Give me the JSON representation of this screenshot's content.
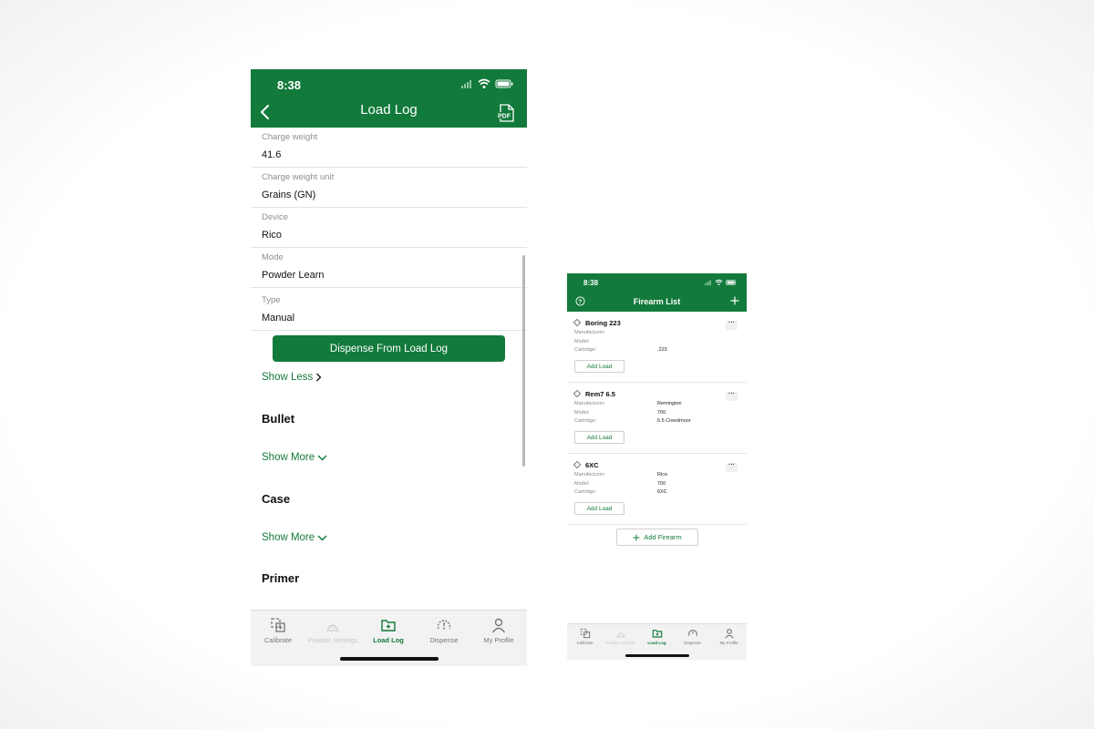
{
  "load_log_screen": {
    "status_time": "8:38",
    "title": "Load Log",
    "fields": [
      {
        "label": "Charge weight",
        "value": "41.6"
      },
      {
        "label": "Charge weight unit",
        "value": "Grains (GN)"
      },
      {
        "label": "Device",
        "value": "Rico"
      },
      {
        "label": "Mode",
        "value": "Powder Learn"
      },
      {
        "label": "Type",
        "value": "Manual"
      }
    ],
    "dispense_button": "Dispense From Load Log",
    "show_less": "Show Less",
    "sections": [
      {
        "title": "Bullet",
        "toggle": "Show More"
      },
      {
        "title": "Case",
        "toggle": "Show More"
      },
      {
        "title": "Primer"
      }
    ],
    "tabs": [
      "Calibrate",
      "Powder Settings",
      "Load Log",
      "Dispense",
      "My Profile"
    ],
    "active_tab": "Load Log"
  },
  "firearm_list_screen": {
    "status_time": "8:38",
    "title": "Firearm List",
    "row_labels": {
      "manufacturer": "Manufacturer:",
      "model": "Model:",
      "cartridge": "Cartridge:"
    },
    "firearms": [
      {
        "name": "Boring 223",
        "manufacturer": "",
        "model": "",
        "cartridge": ".223"
      },
      {
        "name": "Rem7 6.5",
        "manufacturer": "Remington",
        "model": "700",
        "cartridge": "6.5 Creedmoor"
      },
      {
        "name": "6XC",
        "manufacturer": "Rico",
        "model": "700",
        "cartridge": "6XC"
      }
    ],
    "add_load_label": "Add Load",
    "more_label": "···",
    "add_firearm_label": "Add Firearm",
    "tabs": [
      "Calibrate",
      "Powder Settings",
      "Load Log",
      "Dispense",
      "My Profile"
    ],
    "active_tab": "Load Log"
  },
  "colors": {
    "brand_green": "#127a3b"
  },
  "icons": [
    "back-chevron-icon",
    "pdf-icon",
    "help-icon",
    "plus-icon",
    "calibrate-icon",
    "powder-settings-icon",
    "load-log-icon",
    "dispense-icon",
    "profile-icon"
  ]
}
